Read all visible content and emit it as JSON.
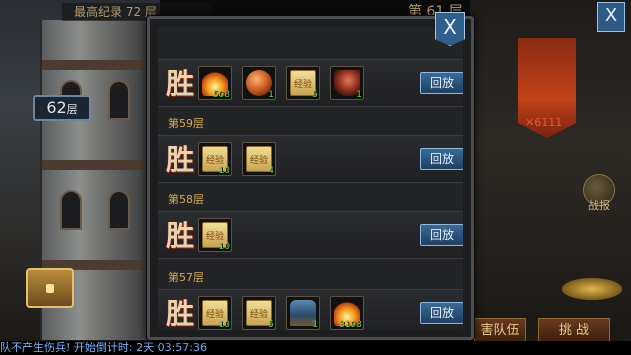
{
  "header": {
    "top_record": "最高纪录 72 层",
    "current_floor": "第 61 层",
    "my_floor_number": "62",
    "my_floor_unit": "层"
  },
  "side": {
    "power_value": "6111",
    "power_prefix": "✕",
    "report_label": "战报",
    "team_button": "害队伍",
    "challenge_button": "挑 战"
  },
  "ticker": "队不产生伤兵!   开始倒计时: 2天 03:57:36",
  "modal": {
    "close_label": "X",
    "win_label": "胜",
    "replay_label": "回放",
    "entries": [
      {
        "floor": "",
        "items": [
          {
            "icon": "flame-icon",
            "count": "508"
          },
          {
            "icon": "orb-icon",
            "count": "1"
          },
          {
            "icon": "exp-scroll-icon",
            "count": "5"
          },
          {
            "icon": "axe-icon",
            "count": "1"
          }
        ]
      },
      {
        "floor": "第59层",
        "items": [
          {
            "icon": "exp-scroll-icon",
            "count": "10"
          },
          {
            "icon": "exp-scroll-icon",
            "count": "4"
          }
        ]
      },
      {
        "floor": "第58层",
        "items": [
          {
            "icon": "exp-scroll-icon",
            "count": "10"
          }
        ]
      },
      {
        "floor": "第57层",
        "items": [
          {
            "icon": "exp-scroll-icon",
            "count": "10"
          },
          {
            "icon": "exp-scroll-icon",
            "count": "5"
          },
          {
            "icon": "armor-icon",
            "count": "1"
          },
          {
            "icon": "flame-icon",
            "count": "3193"
          }
        ]
      }
    ]
  }
}
